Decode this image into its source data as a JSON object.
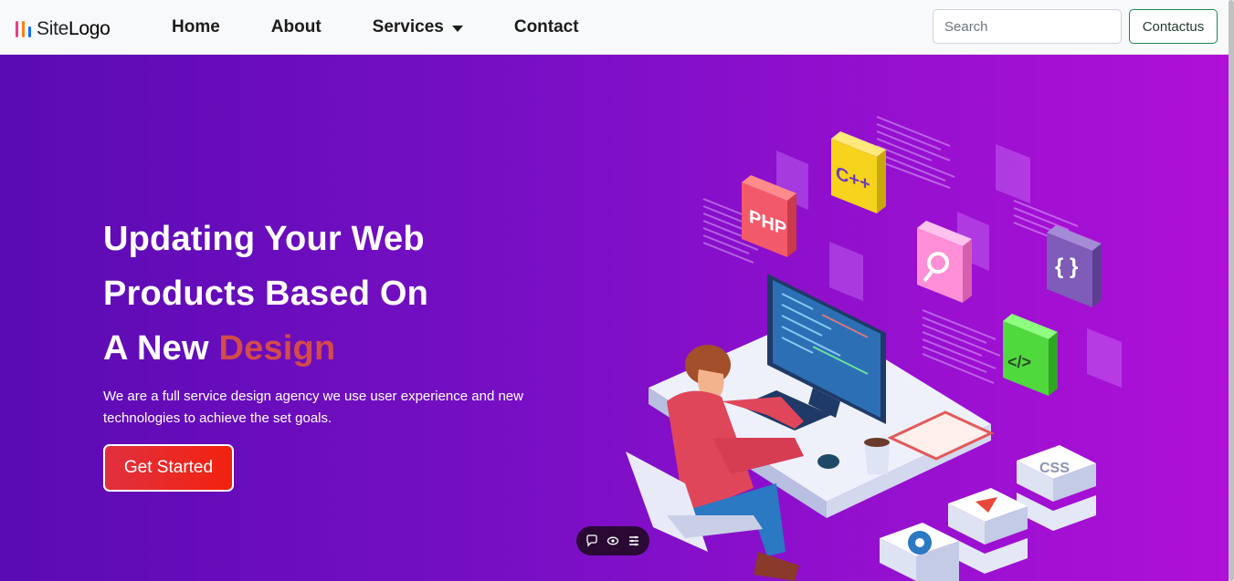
{
  "navbar": {
    "logo": {
      "text_light": "Site",
      "text_bold": "Logo",
      "bar_colors": [
        "#e83e8c",
        "#fd7e14",
        "#0d6efd"
      ]
    },
    "links": [
      {
        "label": "Home"
      },
      {
        "label": "About"
      },
      {
        "label": "Services",
        "has_dropdown": true
      },
      {
        "label": "Contact"
      }
    ],
    "search": {
      "placeholder": "Search",
      "value": ""
    },
    "contact_button": "Contactus"
  },
  "hero": {
    "headline_line1": "Updating Your Web",
    "headline_line2": "Products Based On",
    "headline_line3_prefix": "A New ",
    "headline_line3_accent": "Design",
    "subtext": "We are a full service design agency we use user experience and new technologies to achieve the set goals.",
    "cta_label": "Get Started",
    "illustration_labels": {
      "php": "PHP",
      "cpp": "C++",
      "braces": "{ }",
      "code": "</>",
      "css": "CSS"
    },
    "toolbar_icons": [
      "chat-icon",
      "eye-icon",
      "menu-icon"
    ]
  },
  "colors": {
    "hero_gradient_start": "#5a0bb3",
    "hero_gradient_end": "#b010d8",
    "accent": "#d34b4b",
    "cta": "#e8302a",
    "contact_border": "#198754"
  }
}
